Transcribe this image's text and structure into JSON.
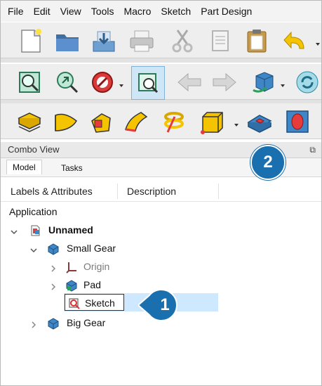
{
  "menu": [
    "File",
    "Edit",
    "View",
    "Tools",
    "Macro",
    "Sketch",
    "Part Design"
  ],
  "combo_view": {
    "title": "Combo View",
    "float_icon": "⧉"
  },
  "tabs": [
    "Model",
    "Tasks"
  ],
  "columns": {
    "labels": "Labels & Attributes",
    "description": "Description"
  },
  "tree": {
    "section": "Application",
    "document": "Unnamed",
    "items": {
      "small_gear": "Small Gear",
      "origin": "Origin",
      "pad": "Pad",
      "sketch": "Sketch",
      "big_gear": "Big Gear"
    }
  },
  "callouts": {
    "one": "1",
    "two": "2"
  },
  "colors": {
    "callout": "#1a6faf",
    "selection": "#cde8ff",
    "partdesign_yellow": "#f5c400",
    "sketch_red": "#e03030"
  }
}
